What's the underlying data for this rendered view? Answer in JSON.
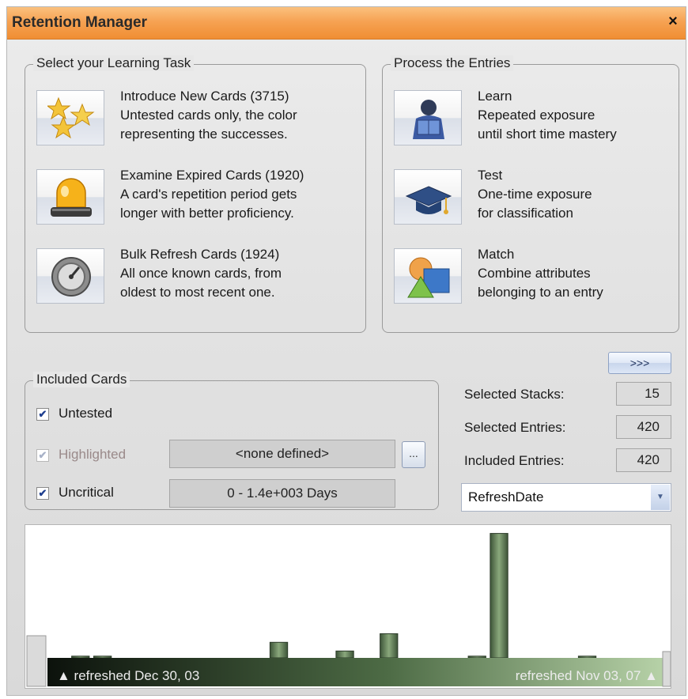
{
  "window": {
    "title": "Retention Manager",
    "close_glyph": "×"
  },
  "learning_task": {
    "legend": "Select your Learning Task",
    "items": [
      {
        "icon": "stars-icon",
        "title": "Introduce New Cards (3715)",
        "line1": "Untested cards only, the color",
        "line2": "representing the successes."
      },
      {
        "icon": "alarm-light-icon",
        "title": "Examine Expired Cards (1920)",
        "line1": "A card's repetition period gets",
        "line2": "longer with better proficiency."
      },
      {
        "icon": "gauge-icon",
        "title": "Bulk Refresh Cards (1924)",
        "line1": "All once known cards, from",
        "line2": "oldest to most recent one."
      }
    ]
  },
  "process": {
    "legend": "Process the Entries",
    "items": [
      {
        "icon": "learner-icon",
        "title": "Learn",
        "line1": "Repeated exposure",
        "line2": "until short time mastery"
      },
      {
        "icon": "graduation-cap-icon",
        "title": "Test",
        "line1": "One-time exposure",
        "line2": "for classification"
      },
      {
        "icon": "match-shapes-icon",
        "title": "Match",
        "line1": "Combine attributes",
        "line2": "belonging to an entry"
      }
    ]
  },
  "nav_button": ">>>",
  "included_cards": {
    "legend": "Included Cards",
    "untested": {
      "label": "Untested",
      "checked": true,
      "mark": "✔"
    },
    "highlighted": {
      "label": "Highlighted",
      "checked": true,
      "mark": "✔",
      "field": "<none defined>",
      "button": "..."
    },
    "uncritical": {
      "label": "Uncritical",
      "checked": true,
      "mark": "✔",
      "field": "0 - 1.4e+003 Days"
    }
  },
  "stats": {
    "selected_stacks": {
      "label": "Selected Stacks:",
      "value": "15"
    },
    "selected_entries": {
      "label": "Selected Entries:",
      "value": "420"
    },
    "included_entries": {
      "label": "Included Entries:",
      "value": "420"
    }
  },
  "sort_combo": {
    "value": "RefreshDate",
    "arrow": "▼"
  },
  "chart_data": {
    "type": "bar",
    "start_label": "▲ refreshed Dec 30, 03",
    "end_label": "refreshed Nov 03, 07 ▲",
    "values": [
      0,
      1,
      1,
      0,
      0,
      0,
      0,
      0,
      0,
      0,
      9,
      0,
      0,
      4,
      0,
      14,
      0,
      0,
      0,
      1,
      72,
      0,
      0,
      0,
      1,
      0,
      0,
      0
    ],
    "ylim": [
      0,
      75
    ]
  }
}
